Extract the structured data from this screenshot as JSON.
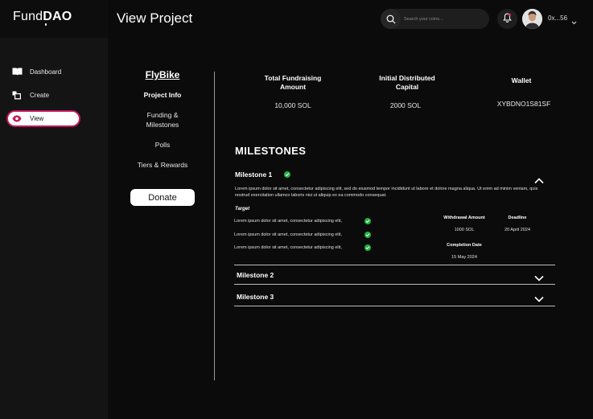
{
  "brand": {
    "logo_prefix": "Fund",
    "logo_suffix": "DAO"
  },
  "sidebar": {
    "items": [
      {
        "label": "Dashboard",
        "icon": "book-icon"
      },
      {
        "label": "Create",
        "icon": "create-icon"
      },
      {
        "label": "View",
        "icon": "eye-icon",
        "active": true
      }
    ]
  },
  "header": {
    "title": "View Project",
    "search_placeholder": "Search your coins...",
    "account": "0x...56"
  },
  "project": {
    "name": "FlyBike",
    "links": [
      "Project Info",
      "Funding & Milestones",
      "Polls",
      "Tiers & Rewards"
    ],
    "donate_label": "Donate"
  },
  "stats": [
    {
      "label": "Total Fundraising Amount",
      "value": "10,000 SOL"
    },
    {
      "label": "Initial Distributed Capital",
      "value": "2000 SOL"
    },
    {
      "label": "Wallet",
      "value": "XYBDNO1S81SF"
    }
  ],
  "milestones": {
    "heading": "MILESTONES",
    "first": {
      "title": "Milestone 1",
      "description": "Lorem ipsum dolor sit amet, consectetur adipiscing elit, sed do eiusmod tempor incididunt ut labore et dolore magna aliqua. Ut enim ad minim veniam, quis nostrud exercitation ullamco laboris nisi ut aliquip ex ea commodo consequat.",
      "target_label": "Target",
      "targets": [
        "Lorem ipsum dolor sit amet, consectetur adipiscing elit,",
        "Lorem ipsum dolor sit amet, consectetur adipiscing elit,",
        "Lorem ipsum dolor sit amet, consectetur adipiscing elit,"
      ],
      "withdrawal_label": "Withdrawal Amount",
      "withdrawal_value": "1000 SOL",
      "deadline_label": "Deadline",
      "deadline_value": "20 April 2024",
      "completion_label": "Completion Date",
      "completion_value": "15 May 2024"
    },
    "collapsed": [
      "Milestone 2",
      "Milestone 3"
    ]
  },
  "colors": {
    "accent": "#c0195a",
    "success": "#1fb344",
    "background": "#0b0b0b",
    "sidebar": "#141414"
  }
}
